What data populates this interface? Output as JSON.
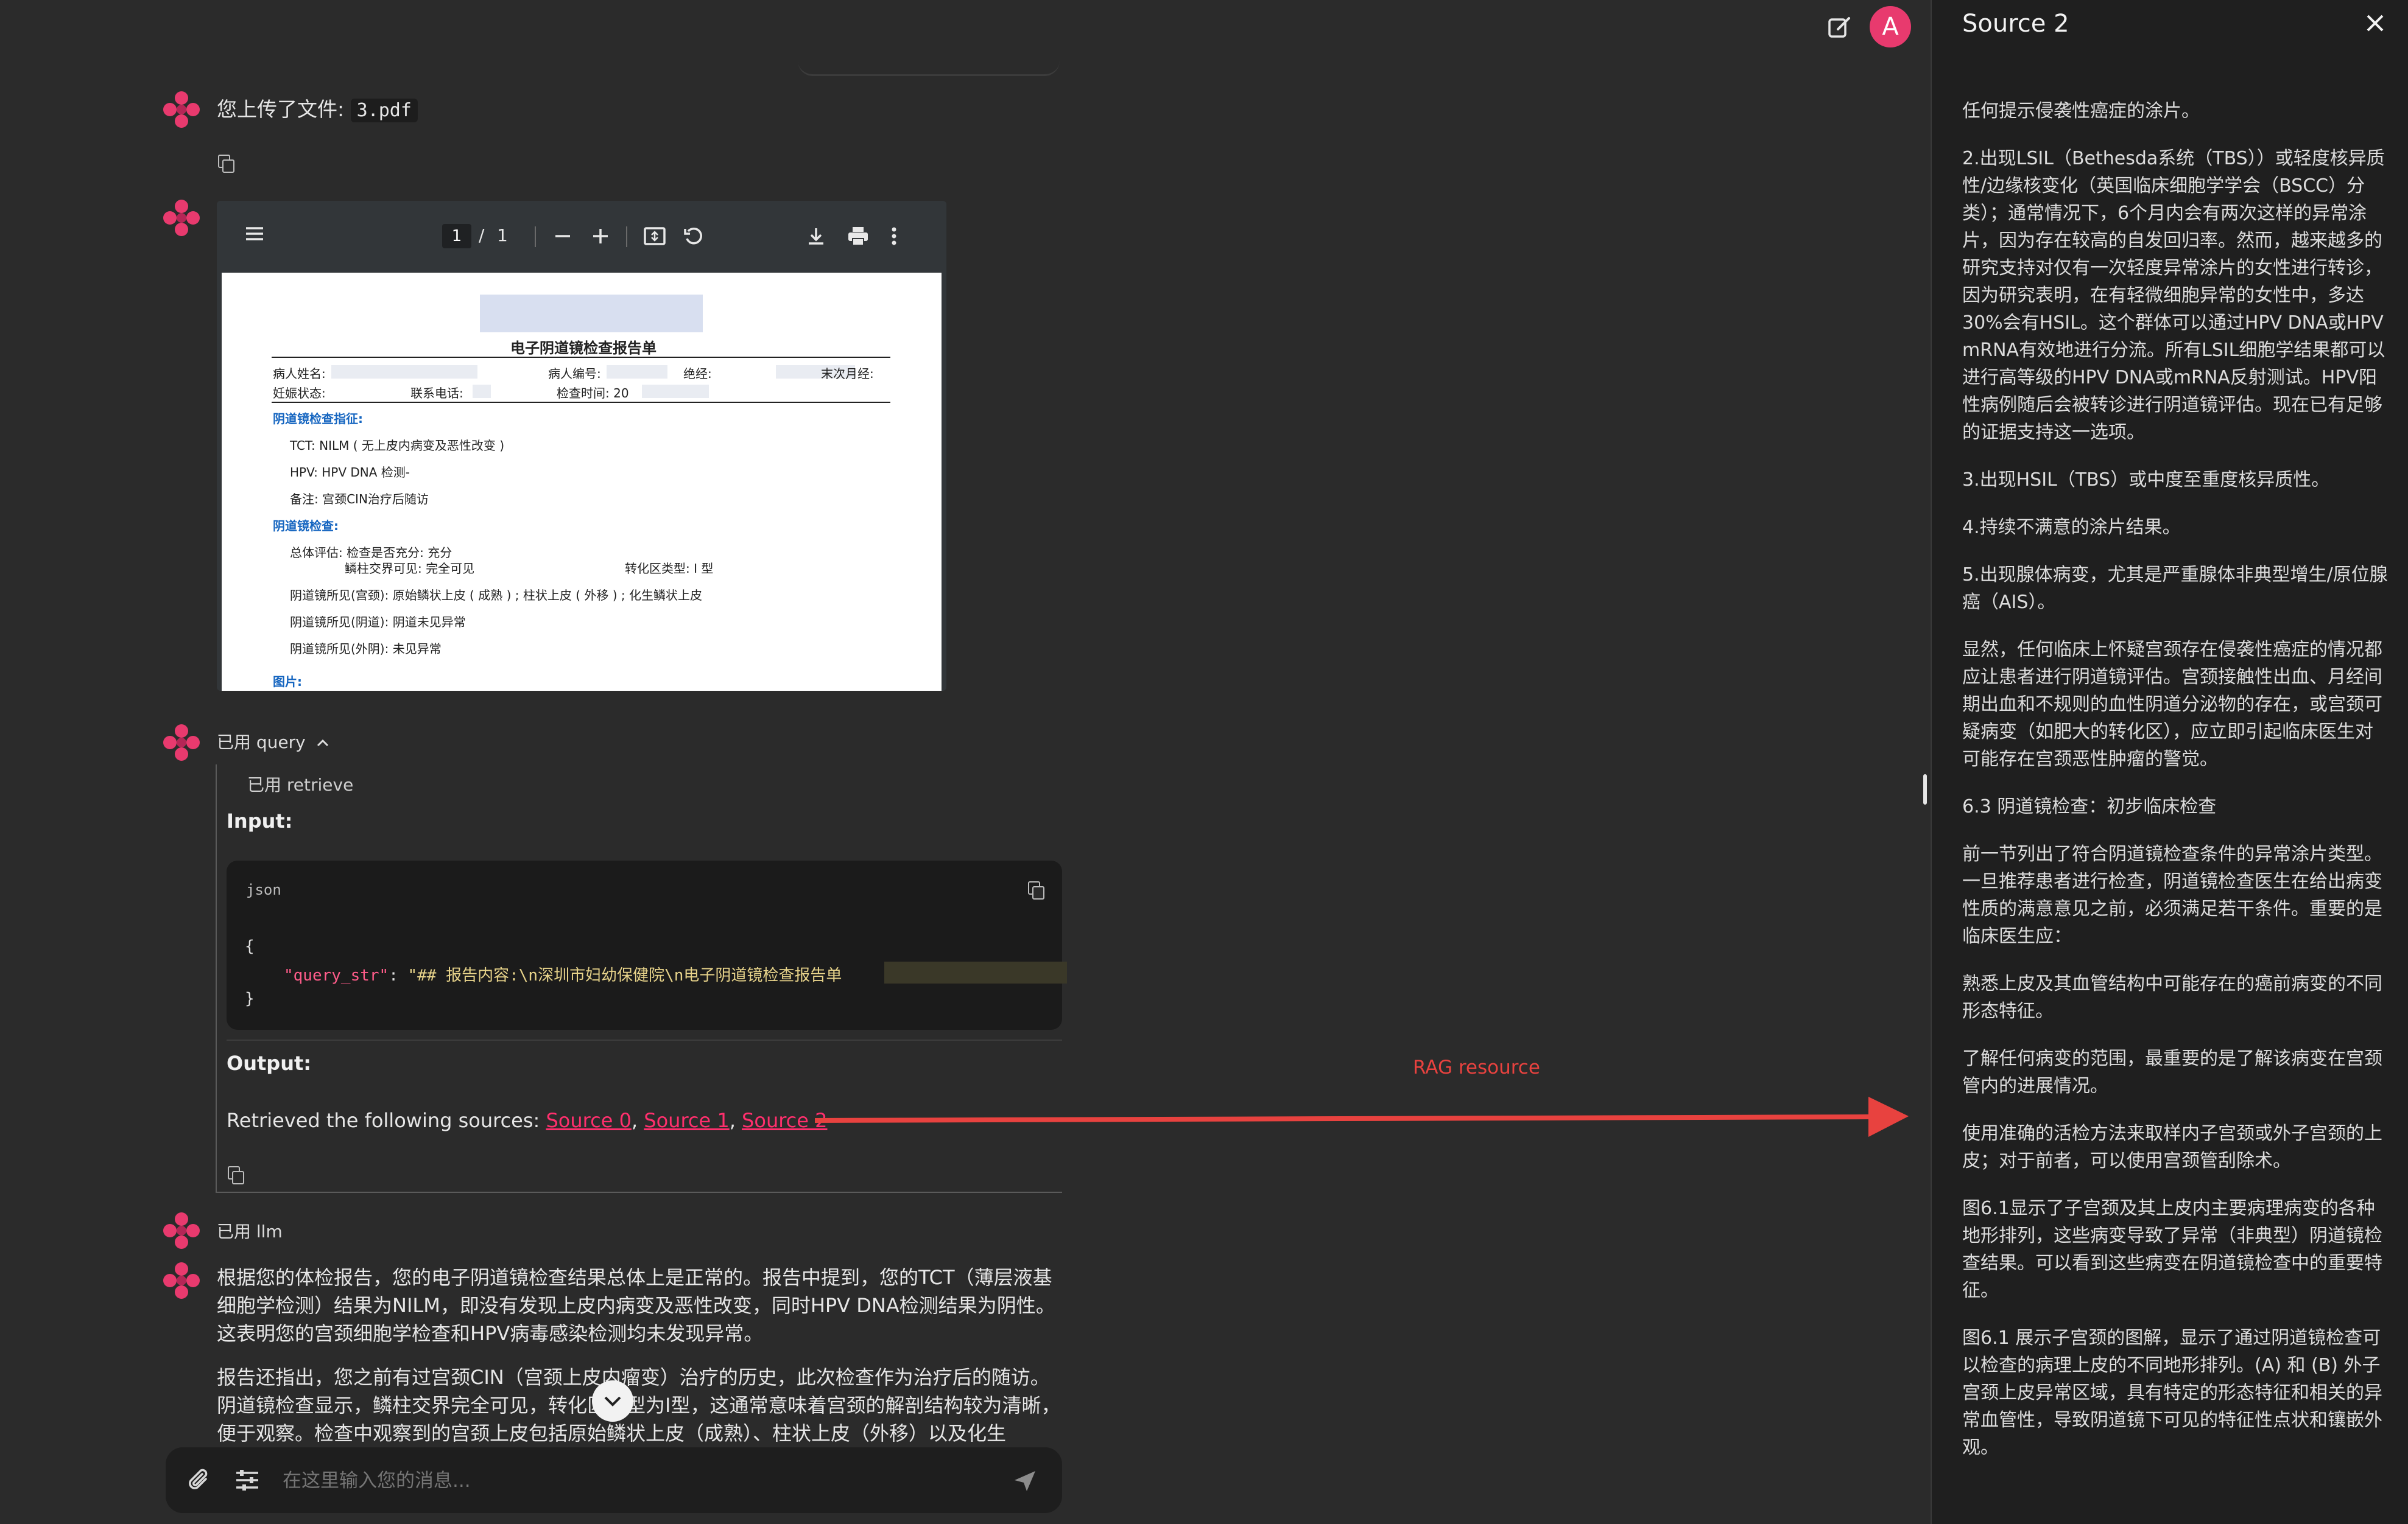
{
  "header": {
    "avatar_letter": "A",
    "accent": "#e83a6e"
  },
  "messages": {
    "upload": {
      "prefix": "您上传了文件: ",
      "filename": "3.pdf"
    },
    "pdf": {
      "page_current": "1",
      "page_sep": "/",
      "page_total": "1",
      "title": "电子阴道镜检查报告单",
      "patient_name": "病人姓名:",
      "patient_id": "病人编号:",
      "menopause": "绝经:",
      "last_period": "末次月经:",
      "pregnancy": "妊娠状态:",
      "phone": "联系电话:",
      "exam_time": "检查时间: 20",
      "indication_heading": "阴道镜检查指征:",
      "tct": "TCT: NILM ( 无上皮内病变及恶性改变 )",
      "hpv": "HPV: HPV DNA 检测-",
      "note": "备注:   宫颈CIN治疗后随访",
      "exam_heading": "阴道镜检查:",
      "overall": "总体评估:  检查是否充分:  充分",
      "squamo": "鳞柱交界可见:  完全可见",
      "tz_type": "转化区类型:   Ⅰ 型",
      "cervix": "阴道镜所见(宫颈): 原始鳞状上皮 ( 成熟 ) ; 柱状上皮 ( 外移 ) ; 化生鳞状上皮",
      "vagina": "阴道镜所见(阴道): 阴道未见异常",
      "vulva": "阴道镜所见(外阴): 未见异常",
      "images": "图片:"
    },
    "query_tool": {
      "label": "已用 query",
      "retrieve_label": "已用 retrieve",
      "input_heading": "Input:",
      "code_lang": "json",
      "code_open": "{",
      "code_key": "\"query_str\"",
      "code_colon": ": ",
      "code_value": "\"## 报告内容:\\n深圳市妇幼保健院\\n电子阴道镜检查报告单",
      "code_close": "}",
      "output_heading": "Output:",
      "output_prefix": "Retrieved the following sources: ",
      "sources": [
        "Source 0",
        "Source 1",
        "Source 2"
      ],
      "comma": ", "
    },
    "llm_tool": {
      "label": "已用 llm"
    },
    "answer": {
      "p1": "根据您的体检报告，您的电子阴道镜检查结果总体上是正常的。报告中提到，您的TCT（薄层液基细胞学检测）结果为NILM，即没有发现上皮内病变及恶性改变，同时HPV DNA检测结果为阴性。这表明您的宫颈细胞学检查和HPV病毒感染检测均未发现异常。",
      "p2": "报告还指出，您之前有过宫颈CIN（宫颈上皮内瘤变）治疗的历史，此次检查作为治疗后的随访。阴道镜检查显示，鳞柱交界完全可见，转化区类型为Ⅰ型，这通常意味着宫颈的解剖结构较为清晰，便于观察。检查中观察到的宫颈上皮包括原始鳞状上皮（成熟）、柱状上皮（外移）以及化生"
    }
  },
  "annotation": {
    "label": "RAG resource",
    "color": "#e8423f"
  },
  "composer": {
    "placeholder": "在这里输入您的消息..."
  },
  "source_panel": {
    "title": "Source 2",
    "paragraphs": [
      "任何提示侵袭性癌症的涂片。",
      "2.出现LSIL（Bethesda系统（TBS））或轻度核异质性/边缘核变化（英国临床细胞学学会（BSCC）分类）；通常情况下，6个月内会有两次这样的异常涂片，因为存在较高的自发回归率。然而，越来越多的研究支持对仅有一次轻度异常涂片的女性进行转诊，因为研究表明，在有轻微细胞异常的女性中，多达30%会有HSIL。这个群体可以通过HPV DNA或HPV mRNA有效地进行分流。所有LSIL细胞学结果都可以进行高等级的HPV DNA或mRNA反射测试。HPV阳性病例随后会被转诊进行阴道镜评估。现在已有足够的证据支持这一选项。",
      "3.出现HSIL（TBS）或中度至重度核异质性。",
      "4.持续不满意的涂片结果。",
      "5.出现腺体病变，尤其是严重腺体非典型增生/原位腺癌（AIS）。",
      "显然，任何临床上怀疑宫颈存在侵袭性癌症的情况都应让患者进行阴道镜评估。宫颈接触性出血、月经间期出血和不规则的血性阴道分泌物的存在，或宫颈可疑病变（如肥大的转化区），应立即引起临床医生对可能存在宫颈恶性肿瘤的警觉。",
      "6.3 阴道镜检查：初步临床检查",
      "前一节列出了符合阴道镜检查条件的异常涂片类型。一旦推荐患者进行检查，阴道镜检查医生在给出病变性质的满意意见之前，必须满足若干条件。重要的是临床医生应：",
      "熟悉上皮及其血管结构中可能存在的癌前病变的不同形态特征。",
      "了解任何病变的范围，最重要的是了解该病变在宫颈管内的进展情况。",
      "使用准确的活检方法来取样内子宫颈或外子宫颈的上皮；对于前者，可以使用宫颈管刮除术。",
      "图6.1显示了子宫颈及其上皮内主要病理病变的各种地形排列，这些病变导致了异常（非典型）阴道镜检查结果。可以看到这些病变在阴道镜检查中的重要特征。",
      "图6.1 展示子宫颈的图解，显示了通过阴道镜检查可以检查的病理上皮的不同地形排列。(A) 和 (B) 外子宫颈上皮异常区域，具有特定的形态特征和相关的异常血管性，导致阴道镜下可见的特征性点状和镶嵌外观。"
    ]
  }
}
